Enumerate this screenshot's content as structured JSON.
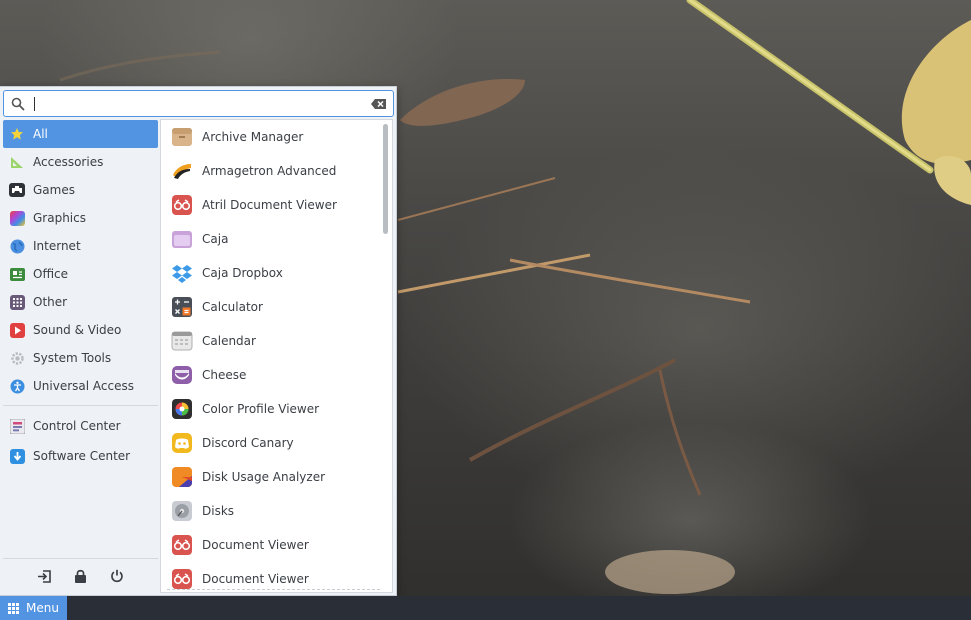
{
  "search": {
    "value": "",
    "placeholder": ""
  },
  "categories": [
    {
      "label": "All",
      "icon": "star-icon",
      "active": true
    },
    {
      "label": "Accessories",
      "icon": "accessories-icon"
    },
    {
      "label": "Games",
      "icon": "gamepad-icon"
    },
    {
      "label": "Graphics",
      "icon": "graphics-icon"
    },
    {
      "label": "Internet",
      "icon": "globe-icon"
    },
    {
      "label": "Office",
      "icon": "office-icon"
    },
    {
      "label": "Other",
      "icon": "grid-icon"
    },
    {
      "label": "Sound & Video",
      "icon": "play-icon"
    },
    {
      "label": "System Tools",
      "icon": "gear-icon"
    },
    {
      "label": "Universal Access",
      "icon": "accessibility-icon"
    }
  ],
  "system": [
    {
      "label": "Control Center",
      "icon": "control-center-icon"
    },
    {
      "label": "Software Center",
      "icon": "software-center-icon"
    }
  ],
  "actions": [
    {
      "name": "logout-icon"
    },
    {
      "name": "lock-icon"
    },
    {
      "name": "power-icon"
    }
  ],
  "apps": [
    {
      "label": "Archive Manager",
      "icon": "archive-icon",
      "color": "#d9b48a"
    },
    {
      "label": "Armagetron Advanced",
      "icon": "armagetron-icon",
      "color": "#222222"
    },
    {
      "label": "Atril Document Viewer",
      "icon": "document-viewer-icon",
      "color": "#d9534f"
    },
    {
      "label": "Caja",
      "icon": "folder-icon",
      "color": "#c8a2d8"
    },
    {
      "label": "Caja Dropbox",
      "icon": "dropbox-icon",
      "color": "#3d9ae8"
    },
    {
      "label": "Calculator",
      "icon": "calculator-icon",
      "color": "#4a4f57"
    },
    {
      "label": "Calendar",
      "icon": "calendar-icon",
      "color": "#e8e8e8"
    },
    {
      "label": "Cheese",
      "icon": "cheese-icon",
      "color": "#8e5fa8"
    },
    {
      "label": "Color Profile Viewer",
      "icon": "color-profile-icon",
      "color": "#2f2f2f"
    },
    {
      "label": "Discord Canary",
      "icon": "discord-icon",
      "color": "#f2b91e"
    },
    {
      "label": "Disk Usage Analyzer",
      "icon": "disk-usage-icon",
      "color": "#f08a24"
    },
    {
      "label": "Disks",
      "icon": "disks-icon",
      "color": "#9a9ea5"
    },
    {
      "label": "Document Viewer",
      "icon": "document-viewer-icon",
      "color": "#d9534f"
    },
    {
      "label": "Document Viewer",
      "icon": "document-viewer-icon",
      "color": "#d9534f"
    }
  ],
  "taskbar": {
    "menu_label": "Menu"
  },
  "colors": {
    "accent": "#5294e2",
    "panel": "#eef1f5",
    "taskbar": "#2a2e36"
  }
}
